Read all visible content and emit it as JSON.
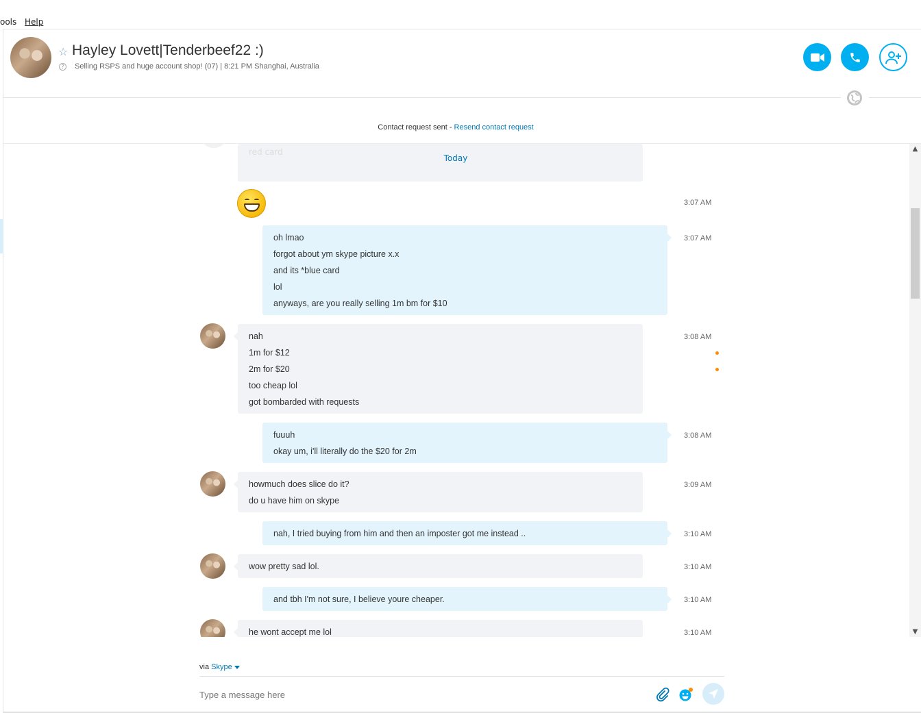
{
  "menu": {
    "tools": "ools",
    "help": "Help"
  },
  "header": {
    "contact_name": "Hayley Lovett|Tenderbeef22 :)",
    "mood": "Selling RSPS and huge account shop! (07)  |  8:21 PM Shanghai, Australia"
  },
  "contact_request": {
    "text": "Contact request sent - ",
    "link": "Resend contact request"
  },
  "chat": {
    "faded_text": "red card",
    "today_label": "Today",
    "messages": [
      {
        "dir": "in",
        "emoji": true,
        "time": "3:07 AM"
      },
      {
        "dir": "out",
        "time": "3:07 AM",
        "lines": [
          "oh lmao",
          "forgot about ym skype picture x.x",
          "and its *blue card",
          "lol",
          "anyways, are you really selling 1m bm for $10"
        ]
      },
      {
        "dir": "in",
        "time": "3:08 AM",
        "lines": [
          "nah",
          "1m for $12",
          "2m for $20",
          "too cheap lol",
          "got bombarded with requests"
        ]
      },
      {
        "dir": "out",
        "time": "3:08 AM",
        "lines": [
          "fuuuh",
          "okay um, i'll literally do the $20 for 2m"
        ]
      },
      {
        "dir": "in",
        "time": "3:09 AM",
        "lines": [
          "howmuch does slice do it?",
          "do u have him on skype"
        ]
      },
      {
        "dir": "out",
        "time": "3:10 AM",
        "lines": [
          "nah, I tried buying from him and then an imposter got me instead .."
        ]
      },
      {
        "dir": "in",
        "time": "3:10 AM",
        "lines": [
          "wow pretty sad lol."
        ]
      },
      {
        "dir": "out",
        "time": "3:10 AM",
        "lines": [
          "and tbh I'm not sure, I believe youre cheaper."
        ]
      },
      {
        "dir": "in",
        "time": "3:10 AM",
        "lines": [
          "he wont accept me lol"
        ]
      }
    ]
  },
  "compose": {
    "via": "via ",
    "via_service": "Skype",
    "placeholder": "Type a message here"
  },
  "colors": {
    "accent": "#00aff0",
    "incoming_bubble": "#f1f3f6",
    "outgoing_bubble": "#e3f4fc",
    "unread_dot": "#ff8c00"
  },
  "icons": [
    "star-icon",
    "mood-info-icon",
    "video-call-icon",
    "audio-call-icon",
    "add-contact-icon",
    "globe-icon",
    "attach-icon",
    "emoticon-icon",
    "send-icon"
  ]
}
